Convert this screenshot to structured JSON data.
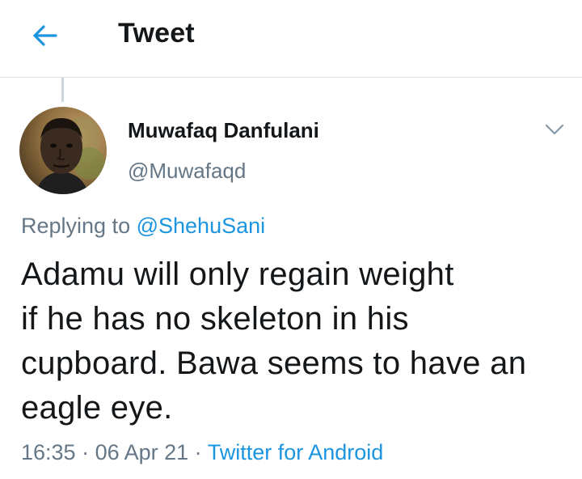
{
  "header": {
    "back_icon": "arrow-left-icon",
    "title": "Tweet"
  },
  "author": {
    "display_name": "Muwafaq Danfulani",
    "handle": "@Muwafaqd",
    "avatar_icon": "user-avatar",
    "menu_icon": "chevron-down-icon"
  },
  "reply": {
    "prefix": "Replying to",
    "mention": "@ShehuSani"
  },
  "tweet": {
    "lines": [
      "Adamu will only regain weight",
      "if he has no skeleton in his",
      "cupboard. Bawa seems to have an",
      "eagle eye."
    ]
  },
  "meta": {
    "time": "16:35",
    "sep1": " · ",
    "date": "06 Apr 21",
    "sep2": " · ",
    "source": "Twitter for Android"
  },
  "colors": {
    "accent": "#1b95e0",
    "text": "#14171a",
    "muted": "#657786",
    "divider": "#dfe3e6"
  }
}
